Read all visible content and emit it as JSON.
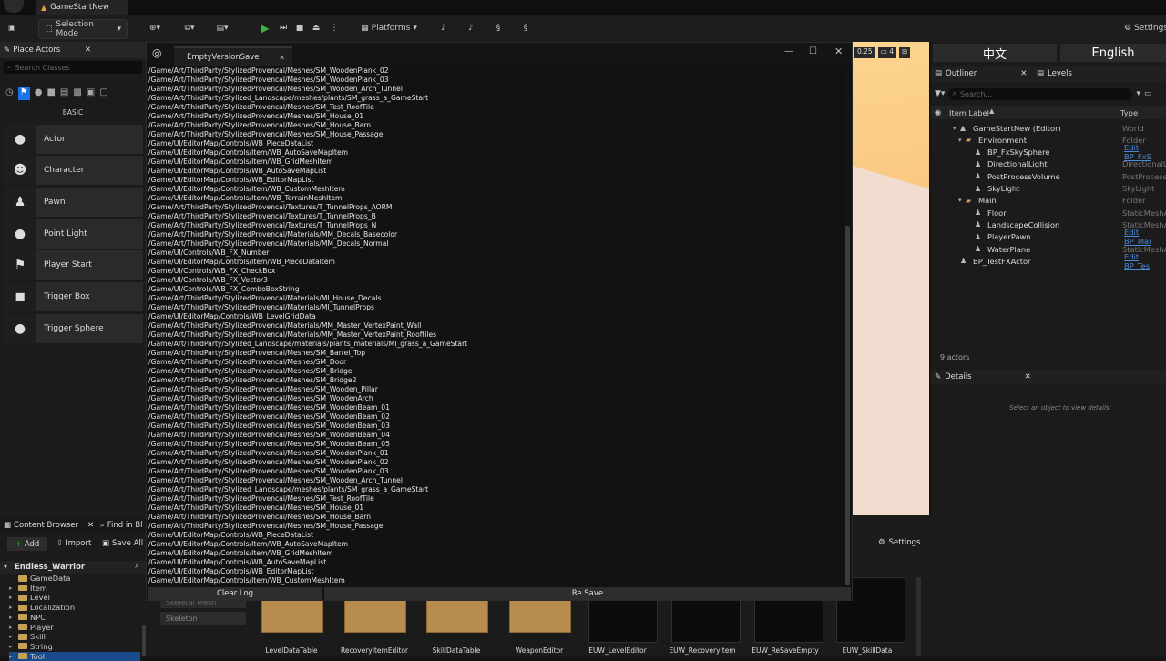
{
  "app": {
    "level_name": "GameStartNew"
  },
  "toolbar": {
    "selection_mode": "Selection Mode",
    "platforms": "Platforms",
    "settings": "Settings"
  },
  "place_actors": {
    "tab": "Place Actors",
    "search_placeholder": "Search Classes",
    "category": "BASIC",
    "items": [
      {
        "label": "Actor",
        "icon": "sphere-icon"
      },
      {
        "label": "Character",
        "icon": "character-icon"
      },
      {
        "label": "Pawn",
        "icon": "pawn-icon"
      },
      {
        "label": "Point Light",
        "icon": "bulb-icon"
      },
      {
        "label": "Player Start",
        "icon": "flag-icon"
      },
      {
        "label": "Trigger Box",
        "icon": "box-icon"
      },
      {
        "label": "Trigger Sphere",
        "icon": "sphere-icon"
      }
    ]
  },
  "dialog": {
    "tab": "EmptyVersionSave",
    "clear_label": "Clear Log",
    "resave_label": "Re Save",
    "log_lines": [
      "/Game/Art/ThirdParty/StylizedProvencal/Meshes/SM_WoodenPlank_02",
      "/Game/Art/ThirdParty/StylizedProvencal/Meshes/SM_WoodenPlank_03",
      "/Game/Art/ThirdParty/StylizedProvencal/Meshes/SM_Wooden_Arch_Tunnel",
      "/Game/Art/ThirdParty/Stylized_Landscape/meshes/plants/SM_grass_a_GameStart",
      "/Game/Art/ThirdParty/StylizedProvencal/Meshes/SM_Test_RoofTile",
      "/Game/Art/ThirdParty/StylizedProvencal/Meshes/SM_House_01",
      "/Game/Art/ThirdParty/StylizedProvencal/Meshes/SM_House_Barn",
      "/Game/Art/ThirdParty/StylizedProvencal/Meshes/SM_House_Passage",
      "/Game/UI/EditorMap/Controls/WB_PieceDataList",
      "/Game/UI/EditorMap/Controls/Item/WB_AutoSaveMapItem",
      "/Game/UI/EditorMap/Controls/Item/WB_GridMeshItem",
      "/Game/UI/EditorMap/Controls/WB_AutoSaveMapList",
      "/Game/UI/EditorMap/Controls/WB_EditorMapList",
      "/Game/UI/EditorMap/Controls/Item/WB_CustomMeshItem",
      "/Game/UI/EditorMap/Controls/Item/WB_TerrainMeshItem",
      "/Game/Art/ThirdParty/StylizedProvencal/Textures/T_TunnelProps_AORM",
      "/Game/Art/ThirdParty/StylizedProvencal/Textures/T_TunnelProps_B",
      "/Game/Art/ThirdParty/StylizedProvencal/Textures/T_TunnelProps_N",
      "/Game/Art/ThirdParty/StylizedProvencal/Materials/MM_Decals_Basecolor",
      "/Game/Art/ThirdParty/StylizedProvencal/Materials/MM_Decals_Normal",
      "/Game/UI/Controls/WB_FX_Number",
      "/Game/UI/EditorMap/Controls/Item/WB_PieceDataItem",
      "/Game/UI/Controls/WB_FX_CheckBox",
      "/Game/UI/Controls/WB_FX_Vector3",
      "/Game/UI/Controls/WB_FX_ComboBoxString",
      "/Game/Art/ThirdParty/StylizedProvencal/Materials/MI_House_Decals",
      "/Game/Art/ThirdParty/StylizedProvencal/Materials/MI_TunnelProps",
      "/Game/UI/EditorMap/Controls/WB_LevelGridData",
      "/Game/Art/ThirdParty/StylizedProvencal/Materials/MM_Master_VertexPaint_Wall",
      "/Game/Art/ThirdParty/StylizedProvencal/Materials/MM_Master_VertexPaint_Rooftiles",
      "/Game/Art/ThirdParty/Stylized_Landscape/materials/plants_materials/MI_grass_a_GameStart",
      "/Game/Art/ThirdParty/StylizedProvencal/Meshes/SM_Barrel_Top",
      "/Game/Art/ThirdParty/StylizedProvencal/Meshes/SM_Door",
      "/Game/Art/ThirdParty/StylizedProvencal/Meshes/SM_Bridge",
      "/Game/Art/ThirdParty/StylizedProvencal/Meshes/SM_Bridge2",
      "/Game/Art/ThirdParty/StylizedProvencal/Meshes/SM_Wooden_Pillar",
      "/Game/Art/ThirdParty/StylizedProvencal/Meshes/SM_WoodenArch",
      "/Game/Art/ThirdParty/StylizedProvencal/Meshes/SM_WoodenBeam_01",
      "/Game/Art/ThirdParty/StylizedProvencal/Meshes/SM_WoodenBeam_02",
      "/Game/Art/ThirdParty/StylizedProvencal/Meshes/SM_WoodenBeam_03",
      "/Game/Art/ThirdParty/StylizedProvencal/Meshes/SM_WoodenBeam_04",
      "/Game/Art/ThirdParty/StylizedProvencal/Meshes/SM_WoodenBeam_05",
      "/Game/Art/ThirdParty/StylizedProvencal/Meshes/SM_WoodenPlank_01",
      "/Game/Art/ThirdParty/StylizedProvencal/Meshes/SM_WoodenPlank_02",
      "/Game/Art/ThirdParty/StylizedProvencal/Meshes/SM_WoodenPlank_03",
      "/Game/Art/ThirdParty/StylizedProvencal/Meshes/SM_Wooden_Arch_Tunnel",
      "/Game/Art/ThirdParty/Stylized_Landscape/meshes/plants/SM_grass_a_GameStart",
      "/Game/Art/ThirdParty/StylizedProvencal/Meshes/SM_Test_RoofTile",
      "/Game/Art/ThirdParty/StylizedProvencal/Meshes/SM_House_01",
      "/Game/Art/ThirdParty/StylizedProvencal/Meshes/SM_House_Barn",
      "/Game/Art/ThirdParty/StylizedProvencal/Meshes/SM_House_Passage",
      "/Game/UI/EditorMap/Controls/WB_PieceDataList",
      "/Game/UI/EditorMap/Controls/Item/WB_AutoSaveMapItem",
      "/Game/UI/EditorMap/Controls/Item/WB_GridMeshItem",
      "/Game/UI/EditorMap/Controls/WB_AutoSaveMapList",
      "/Game/UI/EditorMap/Controls/WB_EditorMapList",
      "/Game/UI/EditorMap/Controls/Item/WB_CustomMeshItem"
    ]
  },
  "viewport": {
    "snap_value": "0.25",
    "camera_speed": "4"
  },
  "right": {
    "lang_cn": "中文",
    "lang_en": "English",
    "outliner_tab": "Outliner",
    "levels_tab": "Levels",
    "search_placeholder": "Search...",
    "col_label": "Item Label",
    "col_type": "Type",
    "actor_count": "9 actors",
    "details_tab": "Details",
    "details_empty": "Select an object to view details.",
    "rows": [
      {
        "label": "GameStartNew (Editor)",
        "type": "World",
        "link": false
      },
      {
        "label": "Environment",
        "type": "Folder",
        "link": false
      },
      {
        "label": "BP_FxSkySphere",
        "type": "Edit BP_FxS",
        "link": true
      },
      {
        "label": "DirectionalLight",
        "type": "DirectionalL",
        "link": false
      },
      {
        "label": "PostProcessVolume",
        "type": "PostProcess",
        "link": false
      },
      {
        "label": "SkyLight",
        "type": "SkyLight",
        "link": false
      },
      {
        "label": "Main",
        "type": "Folder",
        "link": false
      },
      {
        "label": "Floor",
        "type": "StaticMeshA",
        "link": false
      },
      {
        "label": "LandscapeCollision",
        "type": "StaticMeshA",
        "link": false
      },
      {
        "label": "PlayerPawn",
        "type": "Edit BP_Mai",
        "link": true
      },
      {
        "label": "WaterPlane",
        "type": "StaticMeshA",
        "link": false
      },
      {
        "label": "BP_TestFXActor",
        "type": "Edit BP_Tes",
        "link": true
      }
    ]
  },
  "content_browser": {
    "tab": "Content Browser",
    "find_tab": "Find in Bl",
    "add": "Add",
    "import": "Import",
    "save_all": "Save All",
    "settings": "Settings",
    "root": "Endless_Warrior",
    "folders": [
      "GameData",
      "Item",
      "Level",
      "Localization",
      "NPC",
      "Player",
      "Skill",
      "String",
      "Tool"
    ],
    "filters": [
      "Skeletal Mesh",
      "Skeleton"
    ],
    "assets": [
      "LevelDataTable",
      "RecoveryItemEditor",
      "SkillDataTable",
      "WeaponEditor"
    ],
    "widgets": [
      "EUW_LevelEditor",
      "EUW_RecoveryItem",
      "EUW_ReSaveEmpty",
      "EUW_SkillData"
    ]
  },
  "colors": {
    "accent": "#1a73e8",
    "play": "#3fb33f",
    "folder": "#c6a257",
    "link": "#4d8bd6"
  }
}
